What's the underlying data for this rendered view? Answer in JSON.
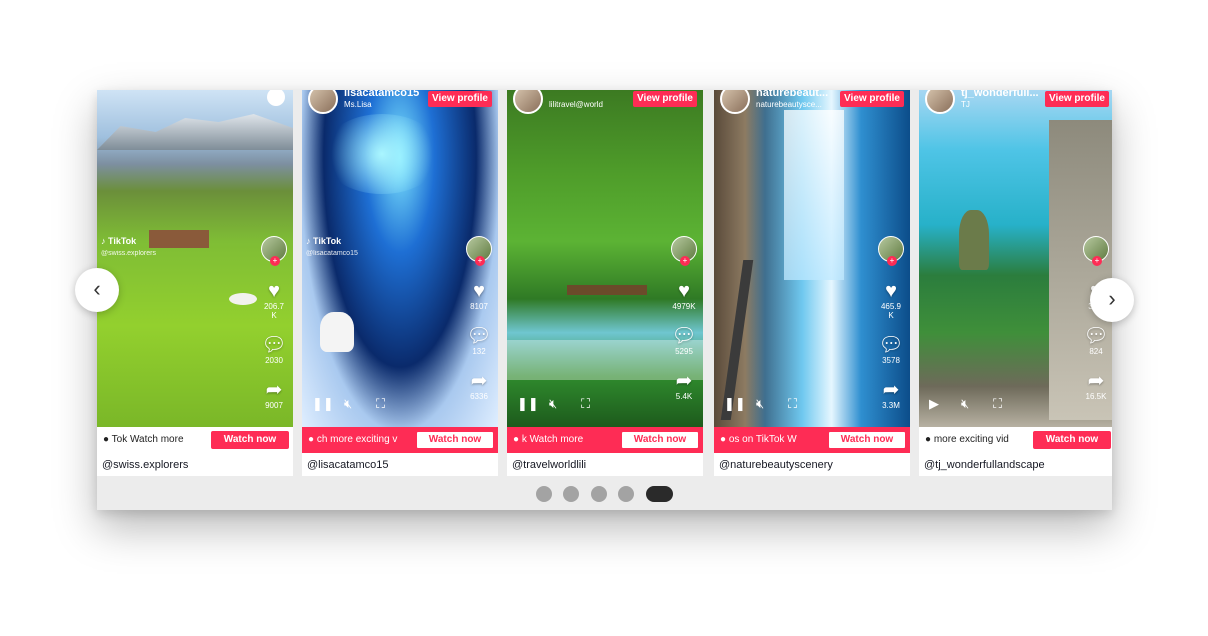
{
  "carousel": {
    "prev_icon": "‹",
    "next_icon": "›",
    "dots_count": 5,
    "active_dot_index": 4
  },
  "cards": [
    {
      "scene": "swiss",
      "username": "",
      "subname": "",
      "view_profile": "",
      "watermark": "♪ TikTok",
      "watermark_sub": "@swiss.explorers",
      "likes": "206.7 K",
      "comments": "2030",
      "shares": "9007",
      "cta_text": "Tok",
      "cta_secondary": "Watch more",
      "cta_style": "white",
      "watch_label": "Watch now",
      "handle": "@swiss.explorers",
      "play_state": "none"
    },
    {
      "scene": "snow",
      "username": "lisacatamco15",
      "subname": "Ms.Lisa",
      "view_profile": "View profile",
      "watermark": "♪ TikTok",
      "watermark_sub": "@lisacatamco15",
      "likes": "8107",
      "comments": "132",
      "shares": "6336",
      "cta_text": "ch more exciting v",
      "cta_secondary": "",
      "cta_style": "red",
      "watch_label": "Watch now",
      "handle": "@lisacatamco15",
      "play_state": "pause"
    },
    {
      "scene": "forest",
      "username": "",
      "subname": "lilitravel@world",
      "view_profile": "View profile",
      "watermark": "",
      "watermark_sub": "",
      "likes": "4979K",
      "comments": "5295",
      "shares": "5.4K",
      "cta_text": "k",
      "cta_secondary": "Watch more",
      "cta_style": "red",
      "watch_label": "Watch now",
      "handle": "@travelworldlili",
      "play_state": "pause"
    },
    {
      "scene": "falls",
      "username": "naturebeaut...",
      "subname": "naturebeautysce...",
      "view_profile": "View profile",
      "watermark": "",
      "watermark_sub": "",
      "likes": "465.9 K",
      "comments": "3578",
      "shares": "3.3M",
      "cta_text": "os on TikTok",
      "cta_secondary": "W",
      "cta_style": "red",
      "watch_label": "Watch now",
      "handle": "@naturebeautyscenery",
      "play_state": "pause"
    },
    {
      "scene": "coast",
      "username": "tj_wonderfull...",
      "subname": "TJ",
      "view_profile": "View profile",
      "watermark": "",
      "watermark_sub": "",
      "likes": "36.2",
      "comments": "824",
      "shares": "16.5K",
      "cta_text": "more exciting vid",
      "cta_secondary": "",
      "cta_style": "white",
      "watch_label": "Watch now",
      "handle": "@tj_wonderfullandscape",
      "play_state": "play"
    }
  ],
  "icons": {
    "like": "heart-icon",
    "comment": "comment-icon",
    "share": "share-icon",
    "pause": "pause-icon",
    "play": "play-icon",
    "mute": "mute-icon",
    "fullscreen": "fullscreen-icon",
    "chat": "chat-bubble-icon"
  },
  "colors": {
    "brand": "#fe2c55",
    "dot": "#a3a3a3",
    "dot_active": "#2a2a2a"
  }
}
